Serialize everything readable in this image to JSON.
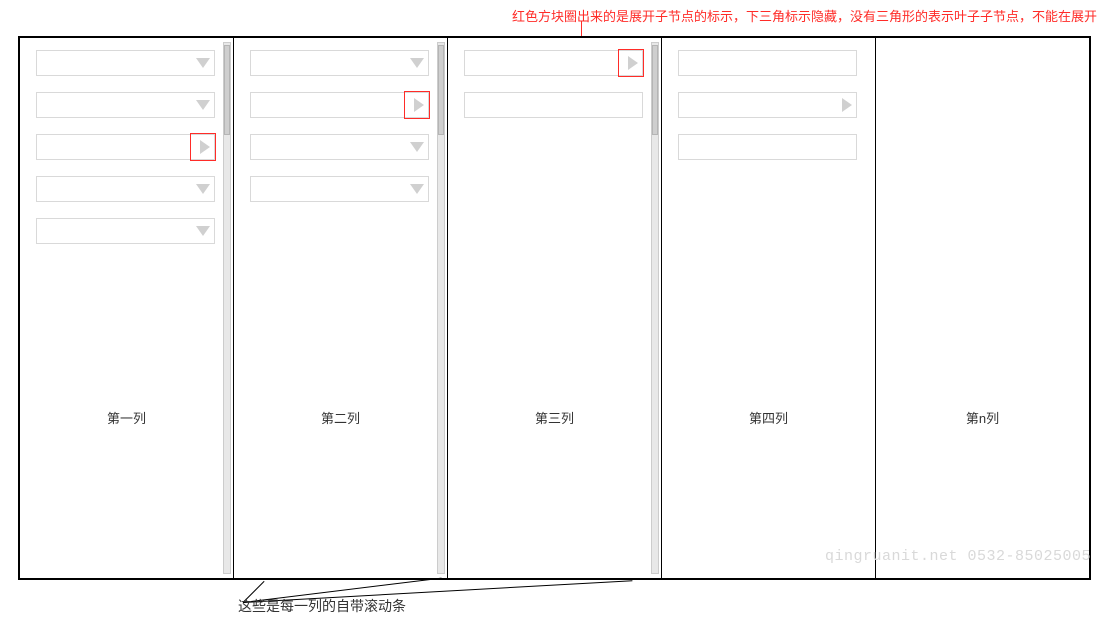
{
  "annotations": {
    "top": "红色方块圈出来的是展开子节点的标示，下三角标示隐藏，没有三角形的表示叶子子节点，不能在展开",
    "bottom": "这些是每一列的自带滚动条"
  },
  "columns": [
    {
      "label": "第一列",
      "has_scrollbar": true,
      "rows": [
        {
          "triangle": "down",
          "highlight": false
        },
        {
          "triangle": "down",
          "highlight": false
        },
        {
          "triangle": "right",
          "highlight": true
        },
        {
          "triangle": "down",
          "highlight": false
        },
        {
          "triangle": "down",
          "highlight": false
        }
      ]
    },
    {
      "label": "第二列",
      "has_scrollbar": true,
      "rows": [
        {
          "triangle": "down",
          "highlight": false
        },
        {
          "triangle": "right",
          "highlight": true
        },
        {
          "triangle": "down",
          "highlight": false
        },
        {
          "triangle": "down",
          "highlight": false
        }
      ]
    },
    {
      "label": "第三列",
      "has_scrollbar": true,
      "rows": [
        {
          "triangle": "right",
          "highlight": true
        },
        {
          "triangle": "none",
          "highlight": false
        }
      ]
    },
    {
      "label": "第四列",
      "has_scrollbar": false,
      "rows": [
        {
          "triangle": "none",
          "highlight": false
        },
        {
          "triangle": "right",
          "highlight": false
        },
        {
          "triangle": "none",
          "highlight": false
        }
      ]
    },
    {
      "label": "第n列",
      "has_scrollbar": false,
      "rows": []
    }
  ],
  "watermark": "qingruanit.net 0532-85025005",
  "colors": {
    "highlight_red": "#ff2c28",
    "row_border": "#d9d9d9",
    "triangle": "#d0d0d0"
  }
}
